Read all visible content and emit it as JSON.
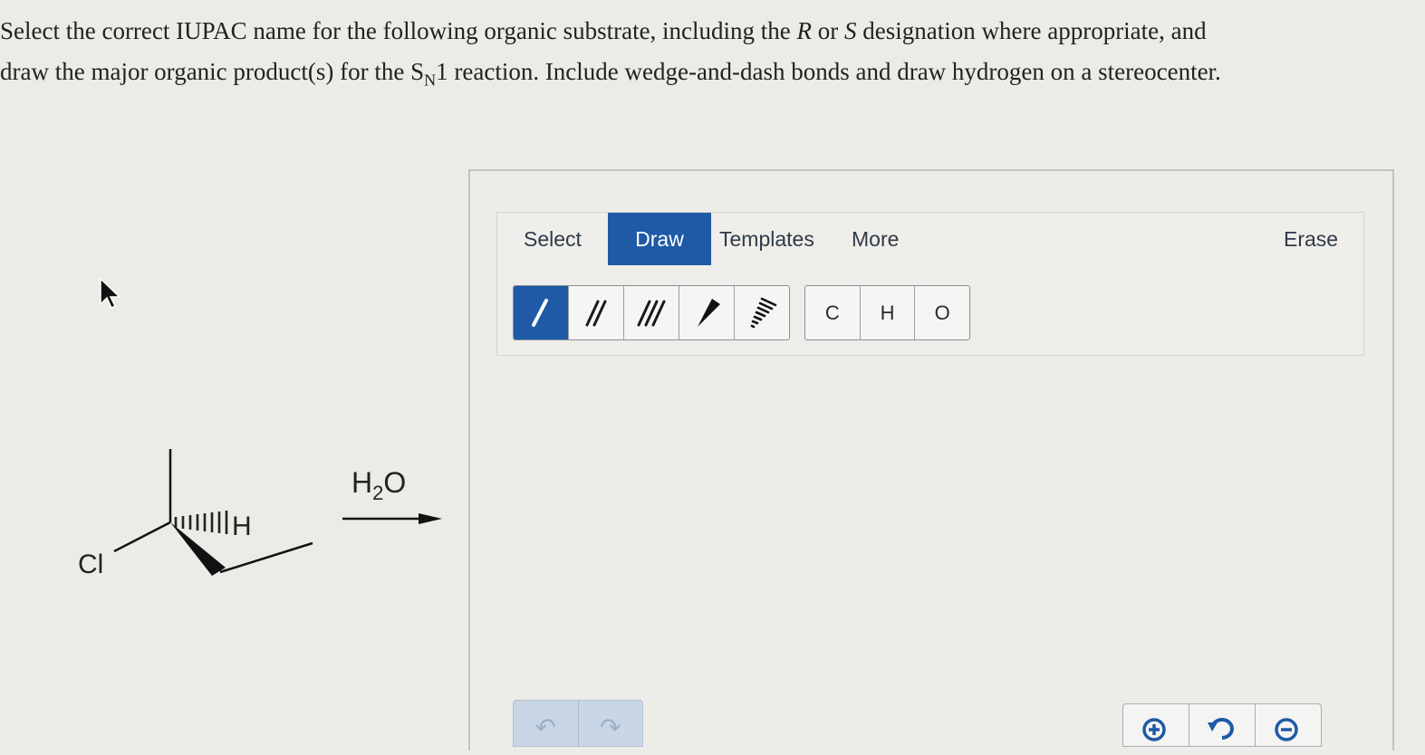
{
  "question": {
    "line1_part1": "Select the correct IUPAC name for the following organic substrate, including the ",
    "r_letter": "R",
    "or_word": " or ",
    "s_letter": "S",
    "line1_part2": " designation where appropriate, and",
    "line2_part1": "draw the major organic product(s) for the S",
    "sub_n": "N",
    "line2_part2": "1 reaction. Include wedge-and-dash bonds and draw hydrogen on a stereocenter."
  },
  "reaction": {
    "leaving_group": "Cl",
    "stereo_h": "H",
    "reagent_main": "H",
    "reagent_sub": "2",
    "reagent_tail": "O"
  },
  "toolbar": {
    "tabs": [
      "Select",
      "Draw",
      "Templates",
      "More"
    ],
    "active_tab": "Draw",
    "erase": "Erase"
  },
  "bond_tools": [
    {
      "name": "single-bond",
      "active": true
    },
    {
      "name": "double-bond",
      "active": false
    },
    {
      "name": "triple-bond",
      "active": false
    },
    {
      "name": "wedge-bond",
      "active": false
    },
    {
      "name": "dash-bond",
      "active": false
    }
  ],
  "atom_tools": [
    "C",
    "H",
    "O"
  ],
  "bottom_controls": {
    "icons": [
      "undo-icon",
      "redo-icon",
      "zoom-in-icon",
      "reset-icon",
      "zoom-out-icon"
    ]
  }
}
